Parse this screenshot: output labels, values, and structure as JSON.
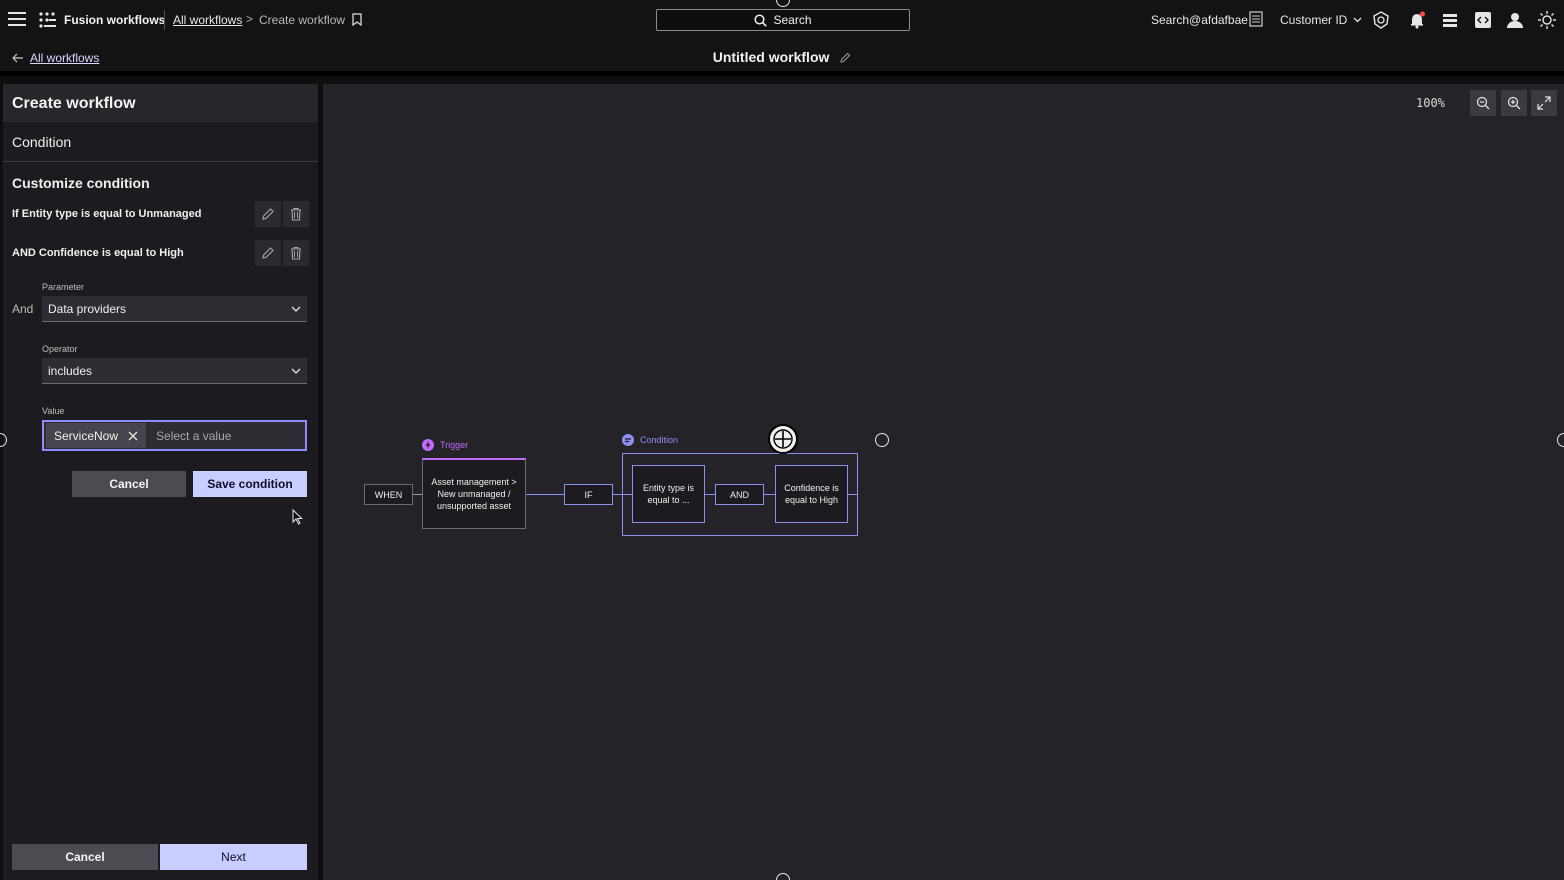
{
  "topbar": {
    "app_title": "Fusion workflows",
    "breadcrumb_link": "All workflows",
    "breadcrumb_sep": ">",
    "breadcrumb_current": "Create workflow",
    "search_label": "Search",
    "user": "Search@afdafbae",
    "customer_label": "Customer ID"
  },
  "subbar": {
    "back_link": "All workflows",
    "workflow_title": "Untitled workflow"
  },
  "panel": {
    "header": "Create workflow",
    "section": "Condition",
    "customize_title": "Customize condition",
    "conditions": [
      {
        "text": "If Entity type is equal to Unmanaged"
      },
      {
        "text": "AND Confidence is equal to High"
      }
    ],
    "and_label": "And",
    "parameter_label": "Parameter",
    "parameter_value": "Data providers",
    "operator_label": "Operator",
    "operator_value": "includes",
    "value_label": "Value",
    "value_chip": "ServiceNow",
    "value_placeholder": "Select a value",
    "cancel_condition": "Cancel",
    "save_condition": "Save condition",
    "footer_cancel": "Cancel",
    "footer_next": "Next"
  },
  "canvas": {
    "zoom": "100%",
    "when_label": "WHEN",
    "trigger_tag": "Trigger",
    "trigger_node": "Asset management > New unmanaged / unsupported asset",
    "if_label": "IF",
    "condition_tag": "Condition",
    "cond_node_1": "Entity type is equal to ...",
    "and_node": "AND",
    "cond_node_2": "Confidence is equal to High"
  },
  "colors": {
    "accent": "#c9cdff",
    "trigger": "#c46bff",
    "condition": "#8c8ff0"
  }
}
